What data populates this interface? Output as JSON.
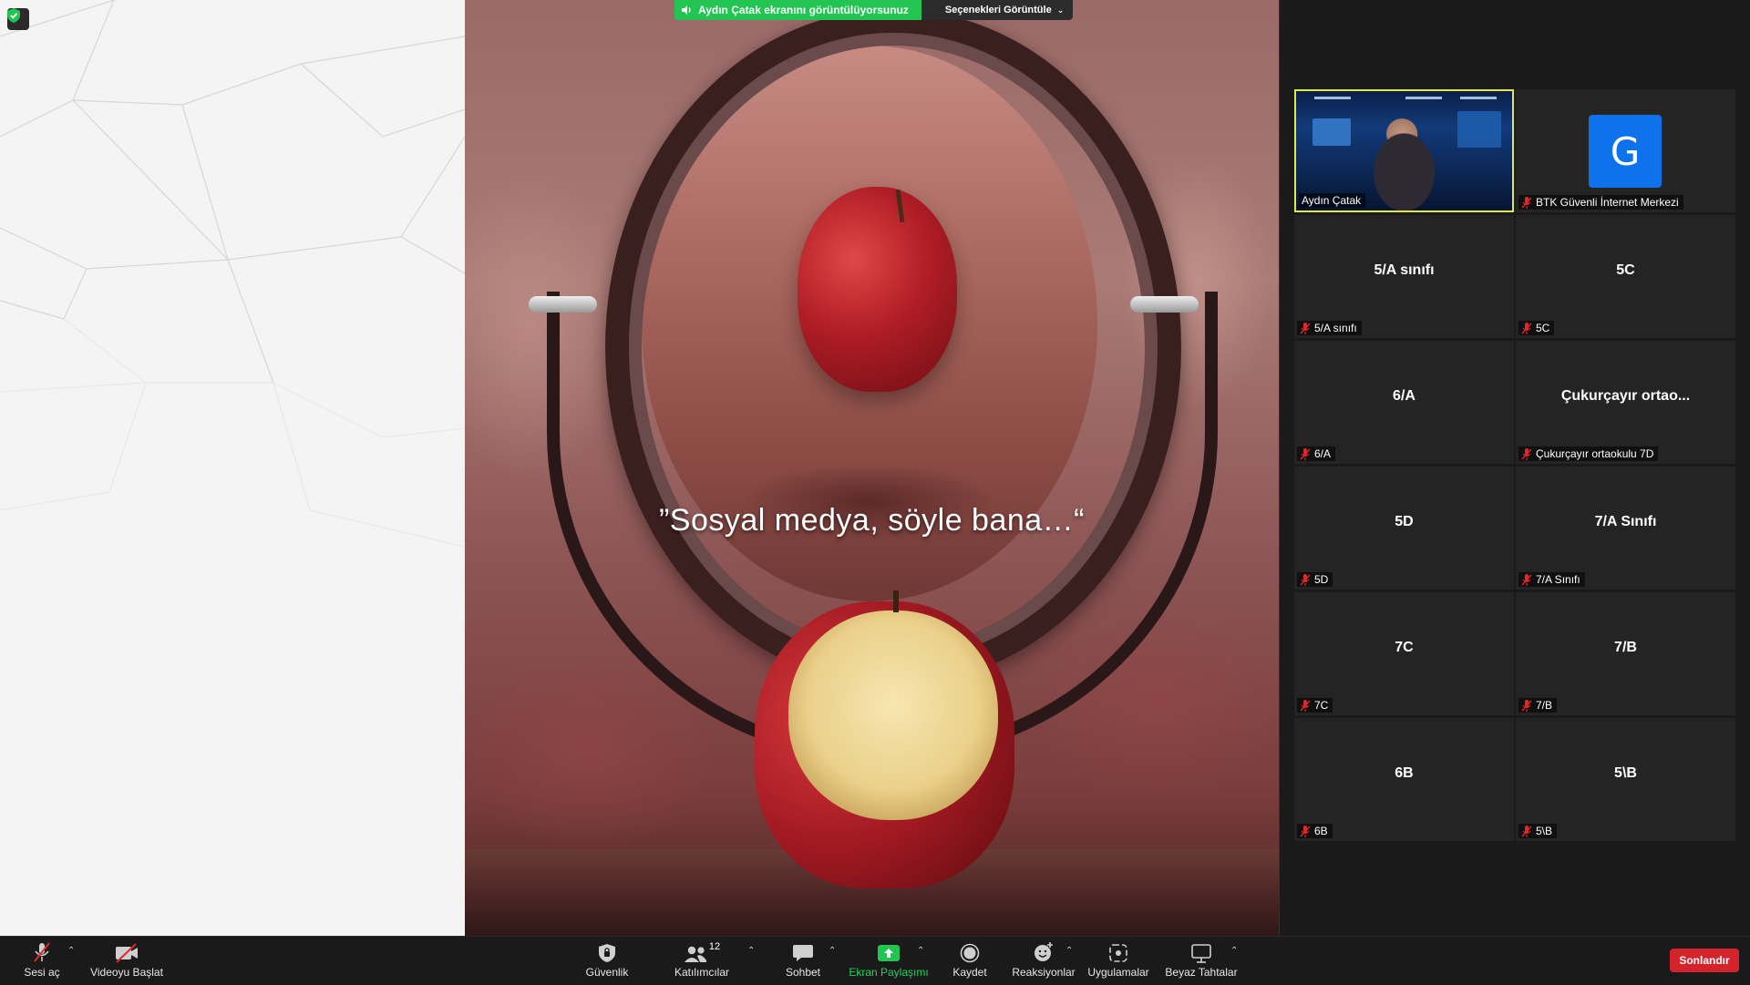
{
  "banner": {
    "status_text": "Aydın Çatak ekranını görüntülüyorsunuz",
    "options_label": "Seçenekleri Görüntüle"
  },
  "shared_content": {
    "quote": "”Sosyal medya, söyle bana…“"
  },
  "gallery": {
    "tiles": [
      {
        "big": "",
        "name": "Aydın Çatak",
        "muted": false,
        "active": true,
        "video": true
      },
      {
        "big": "",
        "name": "BTK Güvenli İnternet Merkezi",
        "muted": true,
        "avatar_letter": "G"
      },
      {
        "big": "5/A sınıfı",
        "name": "5/A sınıfı",
        "muted": true
      },
      {
        "big": "5C",
        "name": "5C",
        "muted": true
      },
      {
        "big": "6/A",
        "name": "6/A",
        "muted": true
      },
      {
        "big": "Çukurçayır ortao...",
        "name": "Çukurçayır ortaokulu 7D",
        "muted": true
      },
      {
        "big": "5D",
        "name": "5D",
        "muted": true
      },
      {
        "big": "7/A Sınıfı",
        "name": "7/A Sınıfı",
        "muted": true
      },
      {
        "big": "7C",
        "name": "7C",
        "muted": true
      },
      {
        "big": "7/B",
        "name": "7/B",
        "muted": true
      },
      {
        "big": "6B",
        "name": "6B",
        "muted": true
      },
      {
        "big": "5\\B",
        "name": "5\\B",
        "muted": true
      }
    ]
  },
  "toolbar": {
    "unmute_label": "Sesi aç",
    "start_video_label": "Videoyu Başlat",
    "security_label": "Güvenlik",
    "participants_label": "Katılımcılar",
    "participants_count": "12",
    "chat_label": "Sohbet",
    "share_screen_label": "Ekran Paylaşımı",
    "record_label": "Kaydet",
    "reactions_label": "Reaksiyonlar",
    "apps_label": "Uygulamalar",
    "whiteboard_label": "Beyaz Tahtalar",
    "end_label": "Sonlandır"
  },
  "colors": {
    "share_green": "#23c552",
    "end_red": "#d5232c",
    "active_speaker_border": "#e2e84a",
    "avatar_blue": "#0e72ed"
  }
}
